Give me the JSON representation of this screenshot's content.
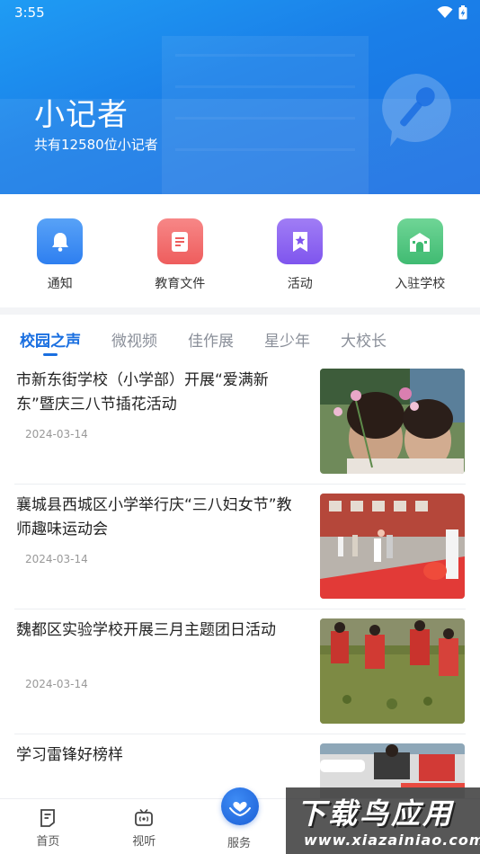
{
  "status_bar": {
    "time": "3:55"
  },
  "header": {
    "title": "小记者",
    "subtitle": "共有12580位小记者",
    "badge_icon": "microphone-icon"
  },
  "quick_entries": [
    {
      "label": "通知",
      "icon": "bell-icon",
      "color": "#3d8df5"
    },
    {
      "label": "教育文件",
      "icon": "document-icon",
      "color": "#f26c6c"
    },
    {
      "label": "活动",
      "icon": "star-bookmark-icon",
      "color": "#8f66f2"
    },
    {
      "label": "入驻学校",
      "icon": "school-icon",
      "color": "#55c784"
    }
  ],
  "tabs": [
    {
      "label": "校园之声",
      "active": true
    },
    {
      "label": "微视频",
      "active": false
    },
    {
      "label": "佳作展",
      "active": false
    },
    {
      "label": "星少年",
      "active": false
    },
    {
      "label": "大校长",
      "active": false
    }
  ],
  "news": [
    {
      "title": "市新东街学校（小学部）开展“爱满新东”暨庆三八节插花活动",
      "date": "2024-03-14"
    },
    {
      "title": "襄城县西城区小学举行庆“三八妇女节”教师趣味运动会",
      "date": "2024-03-14"
    },
    {
      "title": "魏都区实验学校开展三月主题团日活动",
      "date": "2024-03-14"
    },
    {
      "title": "学习雷锋好榜样",
      "date": ""
    }
  ],
  "bottom_nav": [
    {
      "label": "首页",
      "icon": "home-doc-icon"
    },
    {
      "label": "视听",
      "icon": "tv-icon"
    },
    {
      "label": "服务",
      "icon": "heart-hand-icon"
    }
  ],
  "watermark": {
    "main": "下载鸟应用",
    "url": "www.xiazainiao.com"
  },
  "colors": {
    "accent": "#1a6fe0",
    "banner": "#1a7fe8"
  }
}
